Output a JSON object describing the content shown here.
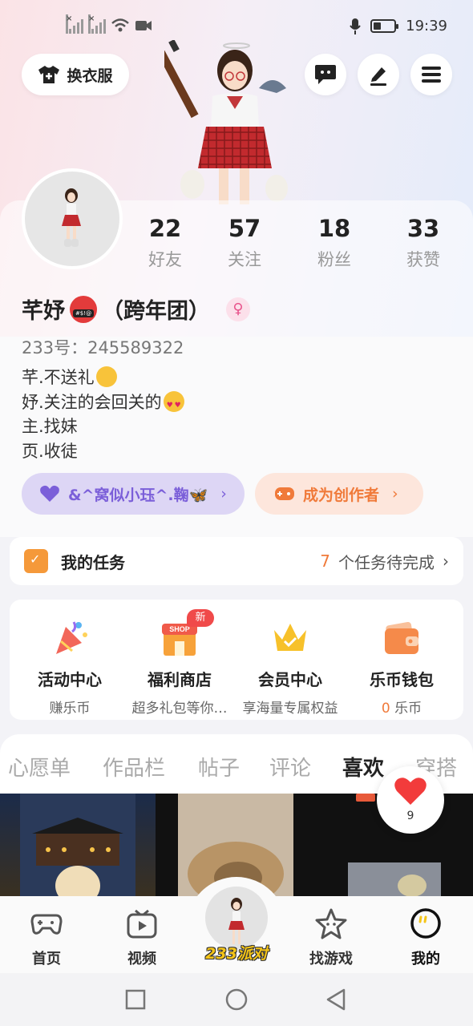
{
  "status_bar": {
    "time": "19:39",
    "battery_level": 0.3
  },
  "header": {
    "dress_button": "换衣服"
  },
  "stats": [
    {
      "num": "22",
      "label": "好友"
    },
    {
      "num": "57",
      "label": "关注"
    },
    {
      "num": "18",
      "label": "粉丝"
    },
    {
      "num": "33",
      "label": "获赞"
    }
  ],
  "profile": {
    "name": "芊妤",
    "name_suffix": "（跨年团）",
    "uid": "233号：245589322",
    "bio": [
      "芊.不送礼",
      "妤.关注的会回关的",
      "主.找妹",
      "页.收徒"
    ],
    "gender": "female"
  },
  "pills": {
    "group": "&^窝似小珏^.鞠🦋",
    "creator": "成为创作者"
  },
  "tasks": {
    "title": "我的任务",
    "count": "7",
    "suffix": "个任务待完成"
  },
  "services": [
    {
      "title": "活动中心",
      "subtitle": "赚乐币",
      "icon": "party-popper-icon"
    },
    {
      "title": "福利商店",
      "subtitle": "超多礼包等你…",
      "icon": "shop-icon",
      "badge": "新",
      "shop_text": "SHOP"
    },
    {
      "title": "会员中心",
      "subtitle": "享海量专属权益",
      "icon": "crown-icon"
    },
    {
      "title": "乐币钱包",
      "subtitle_value": "0",
      "subtitle_unit": "乐币",
      "icon": "wallet-icon"
    }
  ],
  "tabs": [
    "心愿单",
    "作品栏",
    "帖子",
    "评论",
    "喜欢",
    "穿搭"
  ],
  "active_tab": "喜欢",
  "like_float": {
    "count": "9"
  },
  "bottom_nav": [
    {
      "label": "首页",
      "icon": "gamepad-icon"
    },
    {
      "label": "视频",
      "icon": "tv-icon"
    },
    {
      "label": "233派对",
      "icon": "party-avatar"
    },
    {
      "label": "找游戏",
      "icon": "star-icon"
    },
    {
      "label": "我的",
      "icon": "profile-face-icon"
    }
  ],
  "colors": {
    "accent_orange": "#f07a3a",
    "purple": "#7b5fd9",
    "badge_red": "#f04a4a"
  }
}
